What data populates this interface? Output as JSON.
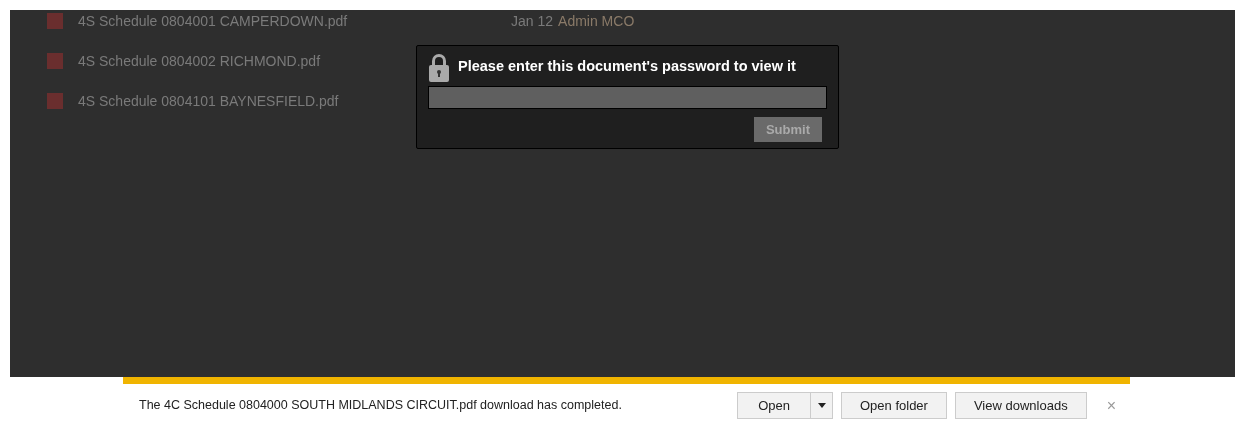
{
  "files": [
    {
      "name": "4S Schedule 0804001 CAMPERDOWN.pdf",
      "date": "Jan 12",
      "author": "Admin MCO"
    },
    {
      "name": "4S Schedule 0804002 RICHMOND.pdf"
    },
    {
      "name": "4S Schedule 0804101 BAYNESFIELD.pdf"
    }
  ],
  "dialog": {
    "title": "Please enter this document's password to view it",
    "submit": "Submit"
  },
  "download_bar": {
    "message": "The 4C Schedule 0804000 SOUTH MIDLANDS CIRCUIT.pdf download has completed.",
    "buttons": [
      "Open",
      "Open folder",
      "View downloads"
    ],
    "close": "×"
  }
}
